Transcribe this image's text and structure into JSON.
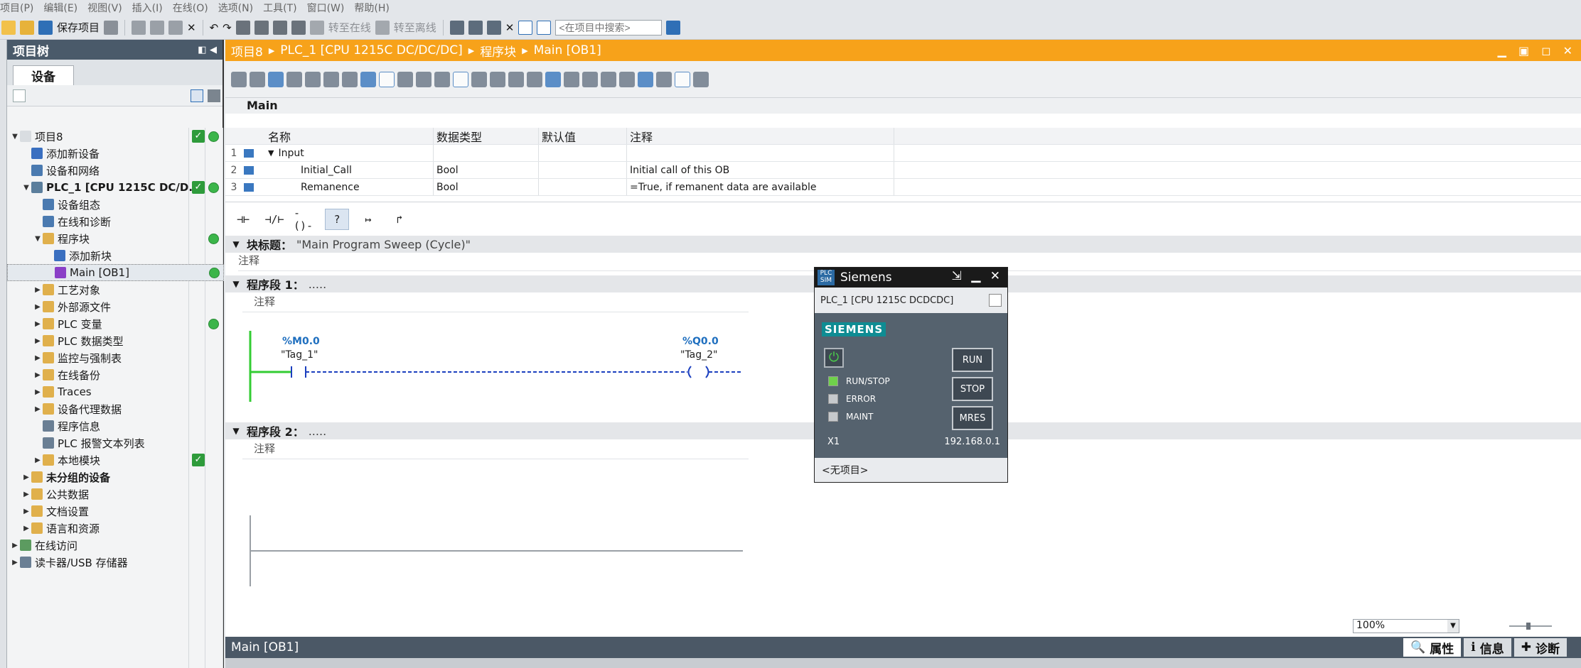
{
  "menu": [
    "项目(P)",
    "编辑(E)",
    "视图(V)",
    "插入(I)",
    "在线(O)",
    "选项(N)",
    "工具(T)",
    "窗口(W)",
    "帮助(H)"
  ],
  "toolbar": {
    "save_label": "保存项目",
    "go_online": "转至在线",
    "go_offline": "转至离线",
    "search_placeholder": "<在项目中搜索>"
  },
  "tree": {
    "header": "项目树",
    "tab": "设备",
    "items": [
      {
        "label": "项目8",
        "level": 0,
        "arrow": "▼",
        "check": true,
        "dot": true,
        "icon": "project-icon"
      },
      {
        "label": "添加新设备",
        "level": 1,
        "arrow": "",
        "icon": "add-device-icon"
      },
      {
        "label": "设备和网络",
        "level": 1,
        "arrow": "",
        "icon": "network-icon"
      },
      {
        "label": "PLC_1 [CPU 1215C DC/D...",
        "level": 1,
        "arrow": "▼",
        "check": true,
        "dot": true,
        "bold": true,
        "icon": "plc-icon"
      },
      {
        "label": "设备组态",
        "level": 2,
        "arrow": "",
        "icon": "device-config-icon"
      },
      {
        "label": "在线和诊断",
        "level": 2,
        "arrow": "",
        "icon": "diagnostics-icon"
      },
      {
        "label": "程序块",
        "level": 2,
        "arrow": "▼",
        "dot": true,
        "icon": "folder-icon"
      },
      {
        "label": "添加新块",
        "level": 3,
        "arrow": "",
        "icon": "add-block-icon"
      },
      {
        "label": "Main [OB1]",
        "level": 3,
        "arrow": "",
        "dot": true,
        "selected": true,
        "icon": "ob-block-icon"
      },
      {
        "label": "工艺对象",
        "level": 2,
        "arrow": "▶",
        "icon": "folder-icon"
      },
      {
        "label": "外部源文件",
        "level": 2,
        "arrow": "▶",
        "icon": "folder-icon"
      },
      {
        "label": "PLC 变量",
        "level": 2,
        "arrow": "▶",
        "dot": true,
        "icon": "folder-icon"
      },
      {
        "label": "PLC 数据类型",
        "level": 2,
        "arrow": "▶",
        "icon": "folder-icon"
      },
      {
        "label": "监控与强制表",
        "level": 2,
        "arrow": "▶",
        "icon": "folder-icon"
      },
      {
        "label": "在线备份",
        "level": 2,
        "arrow": "▶",
        "icon": "folder-icon"
      },
      {
        "label": "Traces",
        "level": 2,
        "arrow": "▶",
        "icon": "folder-icon"
      },
      {
        "label": "设备代理数据",
        "level": 2,
        "arrow": "▶",
        "icon": "folder-icon"
      },
      {
        "label": "程序信息",
        "level": 2,
        "arrow": "",
        "icon": "program-info-icon"
      },
      {
        "label": "PLC 报警文本列表",
        "level": 2,
        "arrow": "",
        "icon": "alarm-text-icon"
      },
      {
        "label": "本地模块",
        "level": 2,
        "arrow": "▶",
        "check": true,
        "icon": "folder-icon"
      },
      {
        "label": "未分组的设备",
        "level": 1,
        "arrow": "▶",
        "bold": true,
        "icon": "folder-icon"
      },
      {
        "label": "公共数据",
        "level": 1,
        "arrow": "▶",
        "icon": "folder-icon"
      },
      {
        "label": "文档设置",
        "level": 1,
        "arrow": "▶",
        "icon": "folder-icon"
      },
      {
        "label": "语言和资源",
        "level": 1,
        "arrow": "▶",
        "icon": "folder-icon"
      },
      {
        "label": "在线访问",
        "level": 0,
        "arrow": "▶",
        "icon": "online-access-icon"
      },
      {
        "label": "读卡器/USB 存储器",
        "level": 0,
        "arrow": "▶",
        "icon": "card-reader-icon"
      }
    ]
  },
  "breadcrumb": [
    "项目8",
    "PLC_1 [CPU 1215C DC/DC/DC]",
    "程序块",
    "Main [OB1]"
  ],
  "block_interface": {
    "block_name": "Main",
    "columns": [
      "名称",
      "数据类型",
      "默认值",
      "注释"
    ],
    "rows": [
      {
        "num": "1",
        "name": "Input",
        "type": "",
        "default": "",
        "comment": ""
      },
      {
        "num": "2",
        "name": "Initial_Call",
        "type": "Bool",
        "default": "",
        "comment": "Initial call of this OB"
      },
      {
        "num": "3",
        "name": "Remanence",
        "type": "Bool",
        "default": "",
        "comment": "=True, if remanent data are available"
      }
    ]
  },
  "block_title": {
    "label": "块标题：",
    "value": "\"Main Program Sweep (Cycle)\"",
    "comment": "注释"
  },
  "networks": [
    {
      "label": "程序段 1：",
      "dots": ".....",
      "comment": "注释",
      "contact": {
        "addr": "%M0.0",
        "tag": "\"Tag_1\""
      },
      "coil": {
        "addr": "%Q0.0",
        "tag": "\"Tag_2\""
      }
    },
    {
      "label": "程序段 2：",
      "dots": ".....",
      "comment": "注释"
    }
  ],
  "plcsim": {
    "title": "Siemens",
    "logo": "PLC SIM",
    "device": "PLC_1 [CPU 1215C DCDCDC]",
    "brand": "SIEMENS",
    "leds": [
      {
        "label": "RUN/STOP",
        "on": true
      },
      {
        "label": "ERROR",
        "on": false
      },
      {
        "label": "MAINT",
        "on": false
      }
    ],
    "buttons": [
      "RUN",
      "STOP",
      "MRES"
    ],
    "iface": "X1",
    "ip": "192.168.0.1",
    "footer": "<无项目>"
  },
  "zoom": "100%",
  "bottom": {
    "title": "Main [OB1]",
    "tabs": [
      "属性",
      "信息",
      "诊断"
    ]
  },
  "colors": {
    "orange": "#f7a21a",
    "tree_header": "#4a5a6a",
    "plcsim_body": "#55626e",
    "brand_teal": "#0f8c93",
    "led_green": "#6fd14b"
  }
}
